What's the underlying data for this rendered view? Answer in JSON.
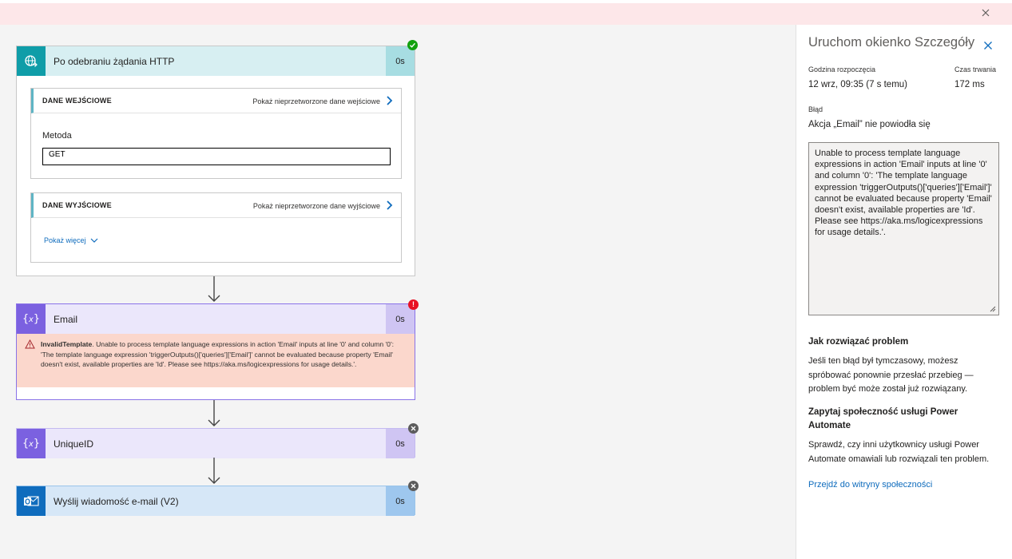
{
  "banner": {
    "close_icon": "close-icon"
  },
  "flow": {
    "trigger": {
      "title": "Po odebraniu żądania HTTP",
      "duration": "0s",
      "status": "succeeded",
      "icon": "globe-request-icon",
      "inputs": {
        "title": "DANE WEJŚCIOWE",
        "raw_link": "Pokaż nieprzetworzone dane wejściowe",
        "method_label": "Metoda",
        "method_value": "GET"
      },
      "outputs": {
        "title": "DANE WYJŚCIOWE",
        "raw_link": "Pokaż nieprzetworzone dane wyjściowe",
        "show_more": "Pokaż więcej"
      }
    },
    "email": {
      "title": "Email",
      "duration": "0s",
      "status": "failed",
      "icon": "variable-icon",
      "error_code": "InvalidTemplate",
      "error_message": ". Unable to process template language expressions in action 'Email' inputs at line '0' and column '0': 'The template language expression 'triggerOutputs()['queries']['Email']' cannot be evaluated because property 'Email' doesn't exist, available properties are 'Id'. Please see https://aka.ms/logicexpressions for usage details.'."
    },
    "unique": {
      "title": "UniqueID",
      "duration": "0s",
      "status": "skipped",
      "icon": "variable-icon"
    },
    "send": {
      "title": "Wyślij wiadomość e-mail (V2)",
      "duration": "0s",
      "status": "skipped",
      "icon": "outlook-icon"
    }
  },
  "panel": {
    "title": "Uruchom okienko Szczegóły",
    "start_label": "Godzina rozpoczęcia",
    "start_value": "12 wrz, 09:35 (7 s temu)",
    "duration_label": "Czas trwania",
    "duration_value": "172 ms",
    "error_label": "Błąd",
    "error_summary": "Akcja „Email” nie powiodła się",
    "error_detail": "Unable to process template language expressions in action 'Email' inputs at line '0' and column '0': 'The template language expression 'triggerOutputs()['queries']['Email']' cannot be evaluated because property 'Email' doesn't exist, available properties are 'Id'. Please see https://aka.ms/logicexpressions for usage details.'.",
    "fix_title": "Jak rozwiązać problem",
    "fix_text": "Jeśli ten błąd był tymczasowy, możesz spróbować ponownie przesłać przebieg — problem być może został już rozwiązany.",
    "community_title": "Zapytaj społeczność usługi Power Automate",
    "community_text": "Sprawdź, czy inni użytkownicy usługi Power Automate omawiali lub rozwiązali ten problem.",
    "community_link": "Przejdź do witryny społeczności"
  },
  "colors": {
    "trigger_accent": "#0f9da8",
    "variable_accent": "#7b61e0",
    "outlook_accent": "#0f6cbd",
    "error_bg": "#fbd7cc",
    "banner_bg": "#fde7e9"
  }
}
